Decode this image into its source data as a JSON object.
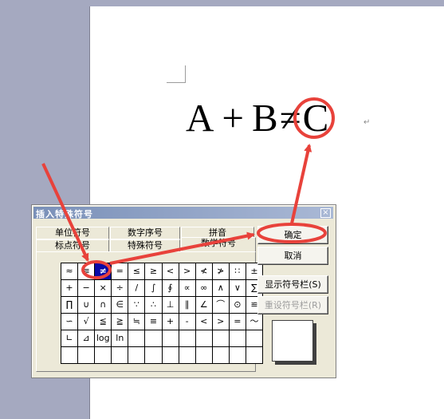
{
  "equation": {
    "a": "A",
    "plus": "+",
    "b": "B",
    "neq": "≠",
    "c": "C",
    "para": "↵"
  },
  "dialog": {
    "title": "插入特殊符号",
    "close": "×",
    "tabs_back": [
      "单位符号",
      "数字序号",
      "拼音"
    ],
    "tabs_front": [
      "标点符号",
      "特殊符号",
      "数学符号"
    ],
    "buttons": {
      "ok": "确定",
      "cancel": "取消",
      "show_bar": "显示符号栏(S)",
      "reset_bar": "重设符号栏(R)"
    }
  },
  "symbols": [
    [
      "≈",
      "≡",
      "≠",
      "=",
      "≤",
      "≥",
      "<",
      ">",
      "≮",
      "≯",
      "∷",
      "±"
    ],
    [
      "+",
      "−",
      "×",
      "÷",
      "/",
      "∫",
      "∮",
      "∝",
      "∞",
      "∧",
      "∨",
      "∑"
    ],
    [
      "∏",
      "∪",
      "∩",
      "∈",
      "∵",
      "∴",
      "⊥",
      "∥",
      "∠",
      "⌒",
      "⊙",
      "≌"
    ],
    [
      "∽",
      "√",
      "≦",
      "≧",
      "≒",
      "≡",
      "+",
      "-",
      "<",
      ">",
      "=",
      "～"
    ],
    [
      "∟",
      "⊿",
      "log",
      "ln",
      "",
      "",
      "",
      "",
      "",
      "",
      "",
      ""
    ],
    [
      "",
      "",
      "",
      "",
      "",
      "",
      "",
      "",
      "",
      "",
      "",
      ""
    ]
  ],
  "selected_symbol": "≠",
  "annotation_color": "#e8423b"
}
